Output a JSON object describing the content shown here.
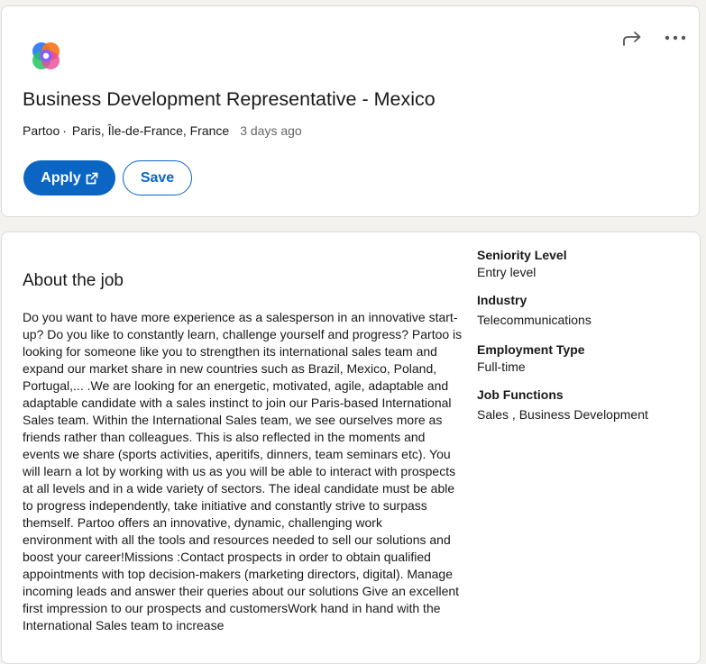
{
  "job": {
    "title": "Business Development Representative - Mexico",
    "company": "Partoo",
    "separator": "·",
    "location": "Paris, Île-de-France, France",
    "posted": "3 days ago"
  },
  "actions": {
    "apply_label": "Apply",
    "save_label": "Save"
  },
  "icons": {
    "logo": "partoo-logo",
    "share": "share-arrow-icon",
    "more": "more-options-icon",
    "external": "external-link-icon"
  },
  "colors": {
    "accent": "#0a66c2",
    "background": "#f3f2ef"
  },
  "about": {
    "heading": "About the job",
    "paragraph1": "Do you want to have more experience as a salesperson in an innovative start-up? Do you like to constantly learn, challenge yourself and progress? Partoo is looking for someone like you to strengthen its international sales team and expand our market share in new countries such as Brazil, Mexico, Poland, Portugal,... .We are looking for an energetic, motivated, agile, adaptable and adaptable candidate with a sales instinct to join our Paris-based International Sales team. Within the International Sales team, we see ourselves more as friends rather than colleagues. This is also reflected in the moments and events we share (sports activities, aperitifs, dinners, team seminars etc). You will learn a lot by working with us as you will be able to interact with prospects at all levels and in a wide variety of sectors. The ideal candidate must be able to progress independently, take initiative and constantly strive to surpass themself. Partoo offers an innovative, dynamic, challenging work",
    "paragraph2": "environment with all the tools and resources needed to sell our solutions and boost your career!Missions :Contact prospects in order to obtain qualified appointments with top decision-makers (marketing directors, digital). Manage incoming leads and answer their queries about our solutions Give an excellent first impression to our prospects and customersWork hand in hand with the International Sales team to increase"
  },
  "criteria": [
    {
      "label": "Seniority Level",
      "value": "Entry level"
    },
    {
      "label": "Industry",
      "value": "Telecommunications"
    },
    {
      "label": "Employment Type",
      "value": "Full-time"
    },
    {
      "label": "Job Functions",
      "value": "Sales , Business Development"
    }
  ]
}
